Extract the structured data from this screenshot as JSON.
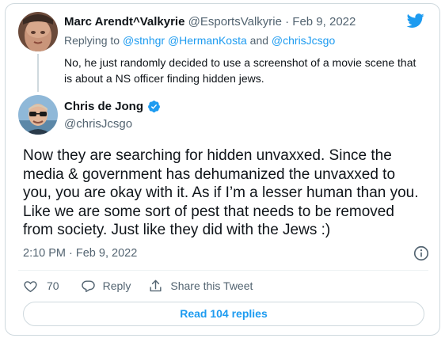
{
  "reply_tweet": {
    "author_name": "Marc Arendt^Valkyrie",
    "author_handle": "@EsportsValkyrie",
    "separator": " · ",
    "date": "Feb 9, 2022",
    "replying_prefix": "Replying to ",
    "mentions": [
      "@stnhgr",
      "@HermanKosta",
      "@chrisJcsgo"
    ],
    "mention_join": " ",
    "mention_and": " and ",
    "text": "No, he just randomly decided to use a screenshot of a movie scene that is about a NS officer finding hidden jews."
  },
  "main_tweet": {
    "author_name": "Chris de Jong",
    "author_handle": "@chrisJcsgo",
    "text": "Now they are searching for hidden unvaxxed. Since the media & government has dehumanized the unvaxxed to you, you are okay with it. As if I’m a lesser human than you. Like we are some sort of pest that needs to be removed from society. Just like they did with the Jews :)",
    "timestamp": "2:10 PM · Feb 9, 2022"
  },
  "actions": {
    "like_count": "70",
    "reply_label": "Reply",
    "share_label": "Share this Tweet"
  },
  "read_replies_label": "Read 104 replies",
  "colors": {
    "twitter_blue": "#1d9bf0",
    "text_primary": "#0f1419",
    "text_secondary": "#536471",
    "border": "#cfd9de"
  },
  "icons": [
    "twitter-logo-icon",
    "verified-badge-icon",
    "info-icon",
    "heart-icon",
    "reply-bubble-icon",
    "share-icon"
  ]
}
